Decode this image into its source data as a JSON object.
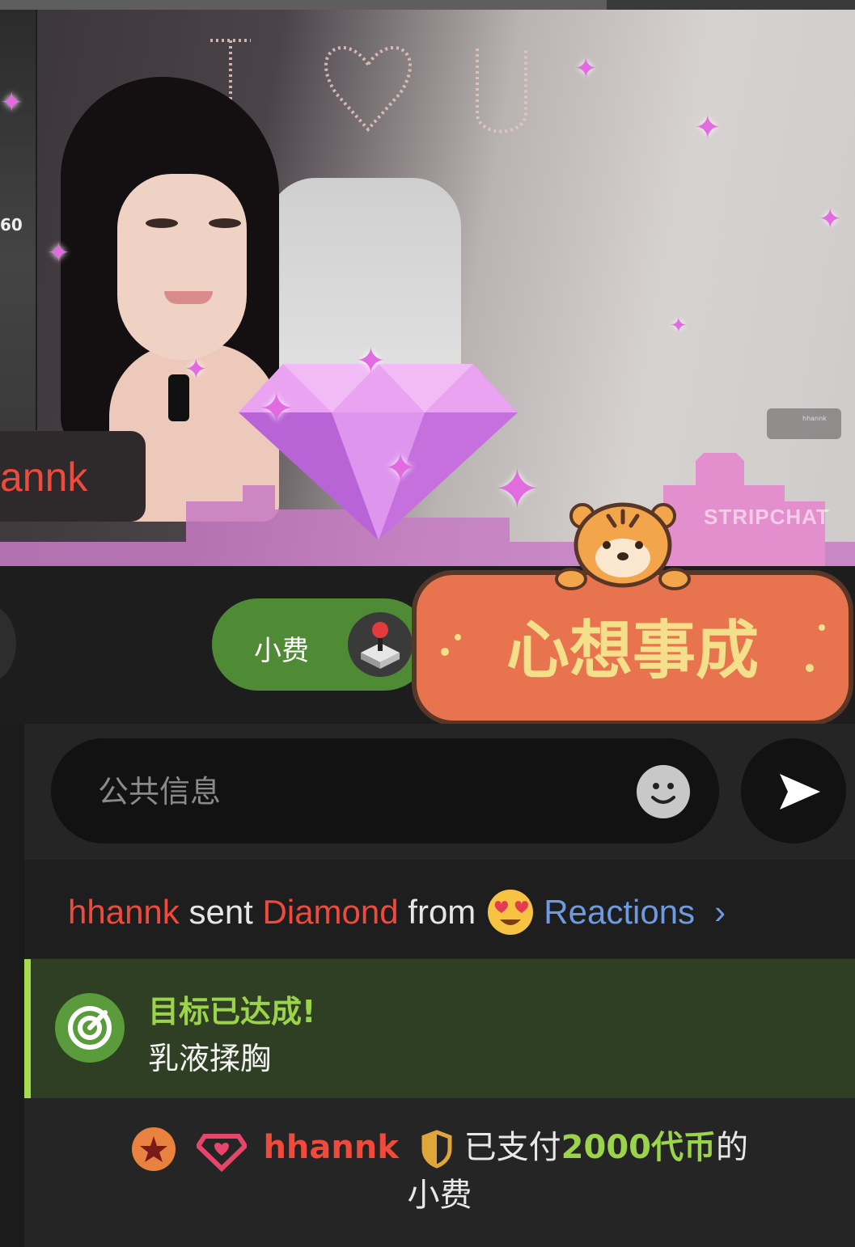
{
  "video": {
    "username_badge": "annk",
    "watermark": "STRIPCHAT",
    "side_number": "60",
    "mini_card_name": "hhannk"
  },
  "controls": {
    "tip_label": "小费"
  },
  "sticker": {
    "text": "心想事成"
  },
  "chat_input": {
    "placeholder": "公共信息"
  },
  "feed": {
    "reaction": {
      "user": "hhannk",
      "sent": "sent",
      "gift": "Diamond",
      "from": "from",
      "source": "Reactions"
    },
    "goal": {
      "title": "目标已达成!",
      "description": "乳液揉胸"
    },
    "tip": {
      "user": "hhannk",
      "prefix": "已支付",
      "amount": "2000代币",
      "suffix": "的",
      "line2": "小费"
    }
  },
  "colors": {
    "accent_green": "#4f8a35",
    "goal_green": "#9bd34a",
    "username_red": "#ef4a3b",
    "link_blue": "#6d9ae0"
  }
}
